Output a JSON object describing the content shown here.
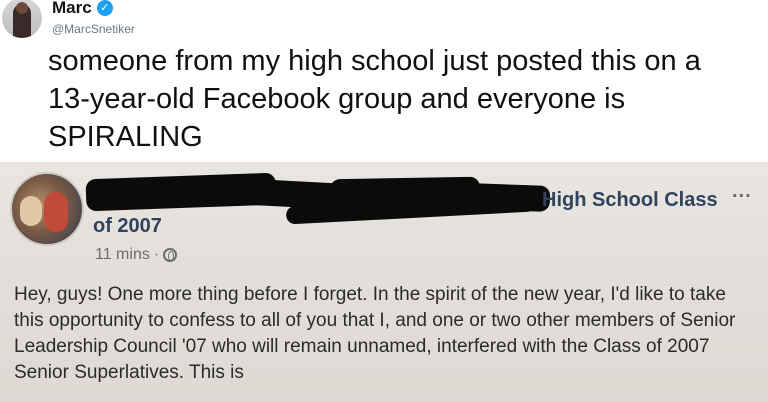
{
  "tweet": {
    "author_name": "Marc",
    "handle": "@MarcSnetiker",
    "text": "someone from my high school just posted this on a 13-year-old Facebook group and everyone is SPIRALING"
  },
  "facebook_post": {
    "group_name_visible": "High School Class",
    "group_name_line2": "of 2007",
    "more_icon": "...",
    "timestamp": "11 mins",
    "separator": "·",
    "body": "Hey, guys! One more thing before I forget. In the spirit of the new year, I'd like to take this opportunity to confess to all of you that I, and one or two other members of Senior Leadership Council '07 who will remain unnamed, interfered with the Class of 2007 Senior Superlatives. This is"
  }
}
